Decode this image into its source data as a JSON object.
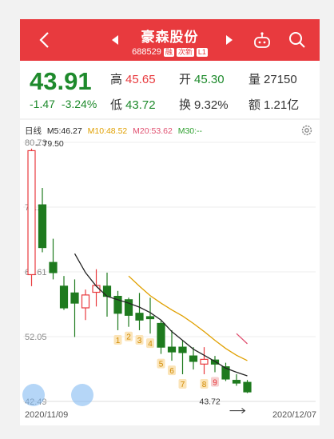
{
  "header": {
    "title": "豪森股份",
    "code": "688529",
    "tags": [
      "融",
      "次新",
      "L1"
    ]
  },
  "quote": {
    "price": "43.91",
    "change": "-1.47",
    "change_pct": "-3.24%",
    "high_label": "高",
    "high": "45.65",
    "open_label": "开",
    "open": "45.30",
    "volume_label": "量",
    "volume": "27150",
    "low_label": "低",
    "low": "43.72",
    "turnover_label": "换",
    "turnover": "9.32%",
    "amount_label": "额",
    "amount": "1.21亿"
  },
  "chart": {
    "period": "日线",
    "ma5": "M5:46.27",
    "ma10": "M10:48.52",
    "ma20": "M20:53.62",
    "ma30": "M30:--",
    "top_price": "79.50",
    "bottom_price": "43.72",
    "date_start": "2020/11/09",
    "date_end": "2020/12/07",
    "colors": {
      "up": "#e83a3e",
      "down": "#1e7a1e",
      "ma5": "#222222",
      "ma10": "#e0a000",
      "ma20": "#e05070",
      "ma30": "#2fa02f"
    }
  },
  "chart_data": {
    "type": "candlestick",
    "y_ticks": [
      "80.73",
      "71.17",
      "61.61",
      "52.05",
      "42.49"
    ],
    "ylim": [
      42.49,
      80.73
    ],
    "candles": [
      {
        "o": 61.2,
        "c": 79.5,
        "h": 79.8,
        "l": 59.5,
        "up": true
      },
      {
        "o": 71.5,
        "c": 65.2,
        "h": 74.0,
        "l": 64.5,
        "up": false
      },
      {
        "o": 63.0,
        "c": 61.5,
        "h": 66.5,
        "l": 60.5,
        "up": false
      },
      {
        "o": 59.5,
        "c": 56.3,
        "h": 61.0,
        "l": 56.0,
        "up": false
      },
      {
        "o": 58.5,
        "c": 57.0,
        "h": 60.5,
        "l": 52.0,
        "up": false
      },
      {
        "o": 56.3,
        "c": 58.2,
        "h": 59.0,
        "l": 54.5,
        "up": true
      },
      {
        "o": 58.6,
        "c": 59.6,
        "h": 62.0,
        "l": 56.5,
        "up": true
      },
      {
        "o": 59.5,
        "c": 58.0,
        "h": 61.5,
        "l": 55.0,
        "up": false
      },
      {
        "o": 58.0,
        "c": 55.5,
        "h": 58.8,
        "l": 53.0,
        "up": false
      },
      {
        "o": 57.5,
        "c": 55.2,
        "h": 57.8,
        "l": 53.5,
        "up": false
      },
      {
        "o": 55.5,
        "c": 54.5,
        "h": 58.5,
        "l": 53.0,
        "up": false
      },
      {
        "o": 55.0,
        "c": 54.7,
        "h": 57.8,
        "l": 52.5,
        "up": false
      },
      {
        "o": 54.0,
        "c": 50.5,
        "h": 54.4,
        "l": 49.5,
        "up": false
      },
      {
        "o": 50.5,
        "c": 49.8,
        "h": 53.0,
        "l": 48.5,
        "up": false
      },
      {
        "o": 50.5,
        "c": 49.7,
        "h": 51.5,
        "l": 46.5,
        "up": false
      },
      {
        "o": 49.2,
        "c": 48.4,
        "h": 50.5,
        "l": 47.2,
        "up": false
      },
      {
        "o": 48.0,
        "c": 48.7,
        "h": 50.5,
        "l": 46.5,
        "up": true
      },
      {
        "o": 48.6,
        "c": 48.0,
        "h": 49.2,
        "l": 46.8,
        "up": false
      },
      {
        "o": 47.6,
        "c": 45.8,
        "h": 48.2,
        "l": 45.5,
        "up": false
      },
      {
        "o": 45.6,
        "c": 45.2,
        "h": 46.5,
        "l": 44.8,
        "up": false
      },
      {
        "o": 45.3,
        "c": 43.9,
        "h": 45.65,
        "l": 43.72,
        "up": false
      }
    ],
    "ma5": [
      null,
      null,
      null,
      null,
      64.3,
      61.5,
      59.5,
      58.0,
      57.5,
      57.0,
      56.4,
      55.6,
      54.5,
      52.8,
      51.5,
      50.2,
      49.3,
      48.4,
      47.4,
      46.8,
      46.27
    ],
    "ma10": [
      null,
      null,
      null,
      null,
      null,
      null,
      null,
      null,
      null,
      61.0,
      59.5,
      58.1,
      57.0,
      56.0,
      55.1,
      54.0,
      52.8,
      51.5,
      50.3,
      49.3,
      48.52
    ],
    "markers": [
      "1",
      "2",
      "3",
      "4",
      "5",
      "6",
      "7",
      "8",
      "9"
    ]
  }
}
